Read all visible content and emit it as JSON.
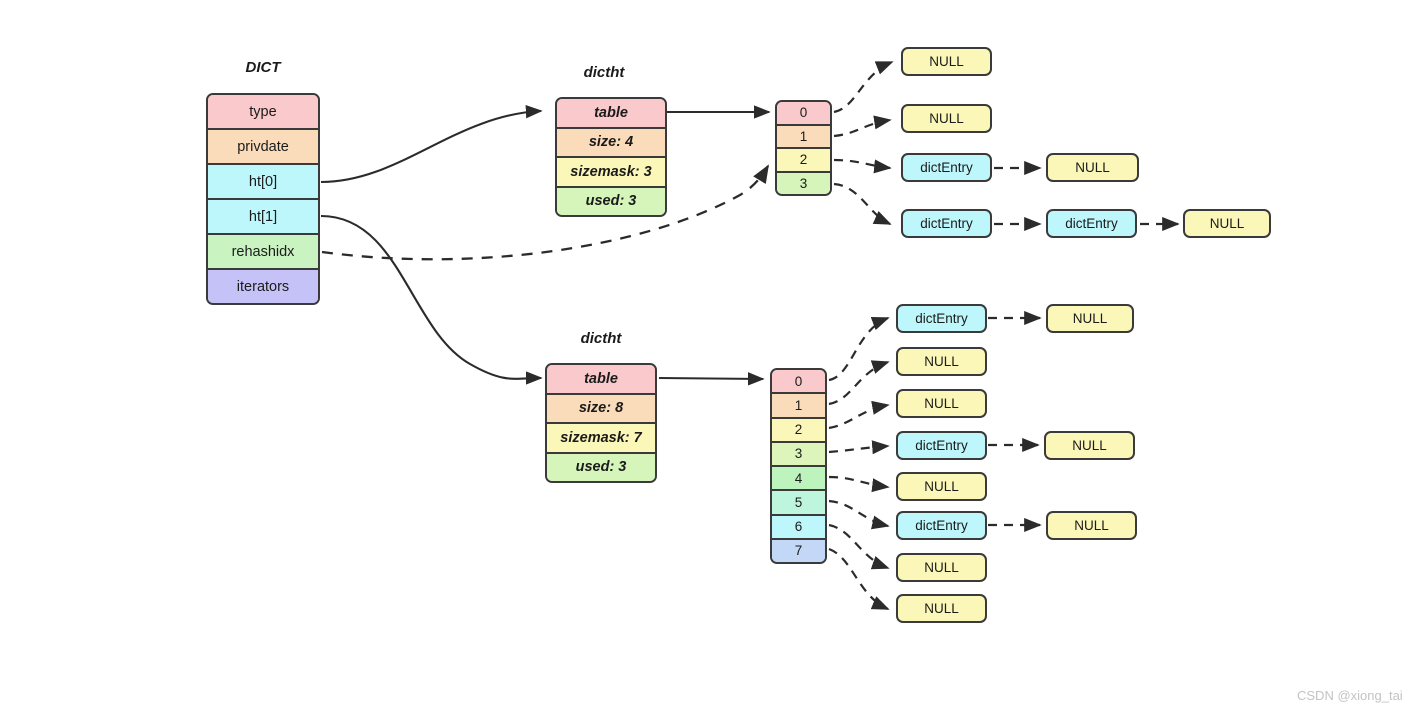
{
  "diagram": {
    "title_dict": "DICT",
    "title_ht0": "dictht",
    "title_ht1": "dictht"
  },
  "dict": {
    "label": "DICT",
    "fields": [
      {
        "label": "type",
        "color": "#f9c9cb"
      },
      {
        "label": "privdate",
        "color": "#fbdcba"
      },
      {
        "label": "ht[0]",
        "color": "#bdf6fb"
      },
      {
        "label": "ht[1]",
        "color": "#bdf6fb"
      },
      {
        "label": "rehashidx",
        "color": "#c9f3c0"
      },
      {
        "label": "iterators",
        "color": "#c4c2f7"
      }
    ]
  },
  "ht0": {
    "caption": "dictht",
    "fields": [
      {
        "label": "table",
        "color": "#f9c9cb"
      },
      {
        "label": "size: 4",
        "color": "#fbdcba"
      },
      {
        "label": "sizemask: 3",
        "color": "#fbf7b8"
      },
      {
        "label": "used: 3",
        "color": "#d6f5bb"
      }
    ],
    "buckets": [
      {
        "label": "0",
        "color": "#f9c9cb"
      },
      {
        "label": "1",
        "color": "#fbdcba"
      },
      {
        "label": "2",
        "color": "#fbf7b8"
      },
      {
        "label": "3",
        "color": "#d6f5bb"
      }
    ],
    "chains": [
      {
        "bucket": "0",
        "nodes": [
          "NULL"
        ]
      },
      {
        "bucket": "1",
        "nodes": [
          "NULL"
        ]
      },
      {
        "bucket": "2",
        "nodes": [
          "dictEntry",
          "NULL"
        ]
      },
      {
        "bucket": "3",
        "nodes": [
          "dictEntry",
          "dictEntry",
          "NULL"
        ]
      }
    ]
  },
  "ht1": {
    "caption": "dictht",
    "fields": [
      {
        "label": "table",
        "color": "#f9c9cb"
      },
      {
        "label": "size: 8",
        "color": "#fbdcba"
      },
      {
        "label": "sizemask: 7",
        "color": "#fbf7b8"
      },
      {
        "label": "used: 3",
        "color": "#d6f5bb"
      }
    ],
    "buckets": [
      {
        "label": "0",
        "color": "#f9c9cb"
      },
      {
        "label": "1",
        "color": "#fbdcba"
      },
      {
        "label": "2",
        "color": "#fbf7b8"
      },
      {
        "label": "3",
        "color": "#ddf5bb"
      },
      {
        "label": "4",
        "color": "#bdf3bd"
      },
      {
        "label": "5",
        "color": "#bdf5dd"
      },
      {
        "label": "6",
        "color": "#bdf6fb"
      },
      {
        "label": "7",
        "color": "#c3d8f7"
      }
    ],
    "chains": [
      {
        "bucket": "0",
        "nodes": [
          "dictEntry",
          "NULL"
        ]
      },
      {
        "bucket": "1",
        "nodes": [
          "NULL"
        ]
      },
      {
        "bucket": "2",
        "nodes": [
          "NULL"
        ]
      },
      {
        "bucket": "3",
        "nodes": [
          "dictEntry",
          "NULL"
        ]
      },
      {
        "bucket": "4",
        "nodes": [
          "NULL"
        ]
      },
      {
        "bucket": "5",
        "nodes": [
          "dictEntry",
          "NULL"
        ]
      },
      {
        "bucket": "6",
        "nodes": [
          "NULL"
        ]
      },
      {
        "bucket": "7",
        "nodes": [
          "NULL"
        ]
      }
    ]
  },
  "node_colors": {
    "dictEntry": "#bdf6fb",
    "NULL": "#fbf7b8"
  },
  "labels": {
    "dictEntry": "dictEntry",
    "null": "NULL"
  },
  "watermark": "CSDN @xiong_tai"
}
